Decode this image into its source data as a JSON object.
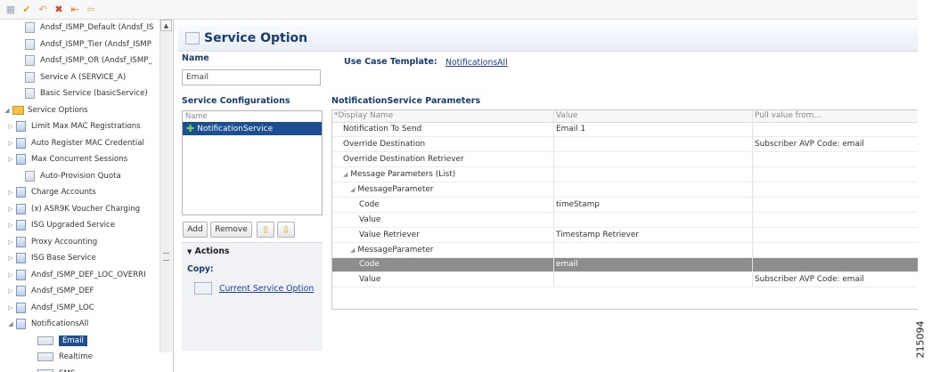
{
  "toolbar": {
    "icons": [
      "select-icon",
      "save-icon",
      "undo-icon",
      "delete-icon",
      "copy-icon",
      "paste-icon"
    ]
  },
  "tree": {
    "items": [
      {
        "label": "Andsf_ISMP_Default (Andsf_IS",
        "depth": 1,
        "icon": "doc",
        "expander": ""
      },
      {
        "label": "Andsf_ISMP_Tier (Andsf_ISMP",
        "depth": 1,
        "icon": "doc",
        "expander": ""
      },
      {
        "label": "Andsf_ISMP_OR (Andsf_ISMP_",
        "depth": 1,
        "icon": "doc",
        "expander": ""
      },
      {
        "label": "Service A (SERVICE_A)",
        "depth": 1,
        "icon": "doc",
        "expander": ""
      },
      {
        "label": "Basic Service (basicService)",
        "depth": 1,
        "icon": "doc",
        "expander": ""
      },
      {
        "label": "Service Options",
        "depth": 0,
        "icon": "folder",
        "expander": "open"
      },
      {
        "label": "Limit Max MAC Registrations",
        "depth": 1,
        "icon": "doc-color",
        "expander": "closed"
      },
      {
        "label": "Auto Register MAC Credential",
        "depth": 1,
        "icon": "doc-color",
        "expander": "closed"
      },
      {
        "label": "Max Concurrent Sessions",
        "depth": 1,
        "icon": "doc-color",
        "expander": "closed"
      },
      {
        "label": "Auto-Provision Quota",
        "depth": 1,
        "icon": "doc",
        "expander": ""
      },
      {
        "label": "Charge Accounts",
        "depth": 1,
        "icon": "doc-color",
        "expander": "closed"
      },
      {
        "label": "(x) ASR9K Voucher Charging",
        "depth": 1,
        "icon": "doc-color",
        "expander": "closed"
      },
      {
        "label": "ISG Upgraded Service",
        "depth": 1,
        "icon": "doc-color",
        "expander": "closed"
      },
      {
        "label": "Proxy Accounting",
        "depth": 1,
        "icon": "doc-color",
        "expander": "closed"
      },
      {
        "label": "ISG Base Service",
        "depth": 1,
        "icon": "doc-color",
        "expander": "closed"
      },
      {
        "label": "Andsf_ISMP_DEF_LOC_OVERRI",
        "depth": 1,
        "icon": "doc-color",
        "expander": "closed"
      },
      {
        "label": "Andsf_ISMP_DEF",
        "depth": 1,
        "icon": "doc-color",
        "expander": "closed"
      },
      {
        "label": "Andsf_ISMP_LOC",
        "depth": 1,
        "icon": "doc-color",
        "expander": "closed"
      },
      {
        "label": "NotificationsAll",
        "depth": 1,
        "icon": "doc-color",
        "expander": "open"
      },
      {
        "label": "Email",
        "depth": 2,
        "icon": "small",
        "expander": "",
        "selected": true
      },
      {
        "label": "Realtime",
        "depth": 2,
        "icon": "small",
        "expander": ""
      },
      {
        "label": "SMS",
        "depth": 2,
        "icon": "small",
        "expander": ""
      }
    ]
  },
  "main": {
    "title": "Service Option",
    "name_label": "Name",
    "name_value": "Email",
    "use_case_label": "Use Case Template:",
    "use_case_link": "NotificationsAll",
    "service_config_label": "Service Configurations",
    "service_config_header": "Name",
    "service_config_item": "NotificationService",
    "buttons": {
      "add": "Add",
      "remove": "Remove"
    },
    "actions": {
      "title": "Actions",
      "copy_label": "Copy:",
      "copy_link": "Current Service Option"
    },
    "params_title": "NotificationService Parameters",
    "params_columns": [
      "*Display Name",
      "Value",
      "Pull value from..."
    ],
    "params_rows": [
      {
        "name": "Notification To Send",
        "value": "Email 1",
        "pull": "",
        "depth": 1,
        "caret": false
      },
      {
        "name": "Override Destination",
        "value": "",
        "pull": "Subscriber AVP Code: email",
        "depth": 1,
        "caret": false
      },
      {
        "name": "Override Destination Retriever",
        "value": "",
        "pull": "",
        "depth": 1,
        "caret": false
      },
      {
        "name": "Message Parameters (List)",
        "value": "",
        "pull": "",
        "depth": 1,
        "caret": true
      },
      {
        "name": "MessageParameter",
        "value": "",
        "pull": "",
        "depth": 2,
        "caret": true
      },
      {
        "name": "Code",
        "value": "timeStamp",
        "pull": "",
        "depth": 3,
        "caret": false
      },
      {
        "name": "Value",
        "value": "",
        "pull": "",
        "depth": 3,
        "caret": false
      },
      {
        "name": "Value Retriever",
        "value": "Timestamp Retriever",
        "pull": "",
        "depth": 3,
        "caret": false
      },
      {
        "name": "MessageParameter",
        "value": "",
        "pull": "",
        "depth": 2,
        "caret": true
      },
      {
        "name": "Code",
        "value": "email",
        "pull": "",
        "depth": 3,
        "caret": false,
        "highlight": true
      },
      {
        "name": "Value",
        "value": "",
        "pull": "Subscriber AVP Code: email",
        "depth": 3,
        "caret": false
      }
    ]
  },
  "figure_id": "215094"
}
